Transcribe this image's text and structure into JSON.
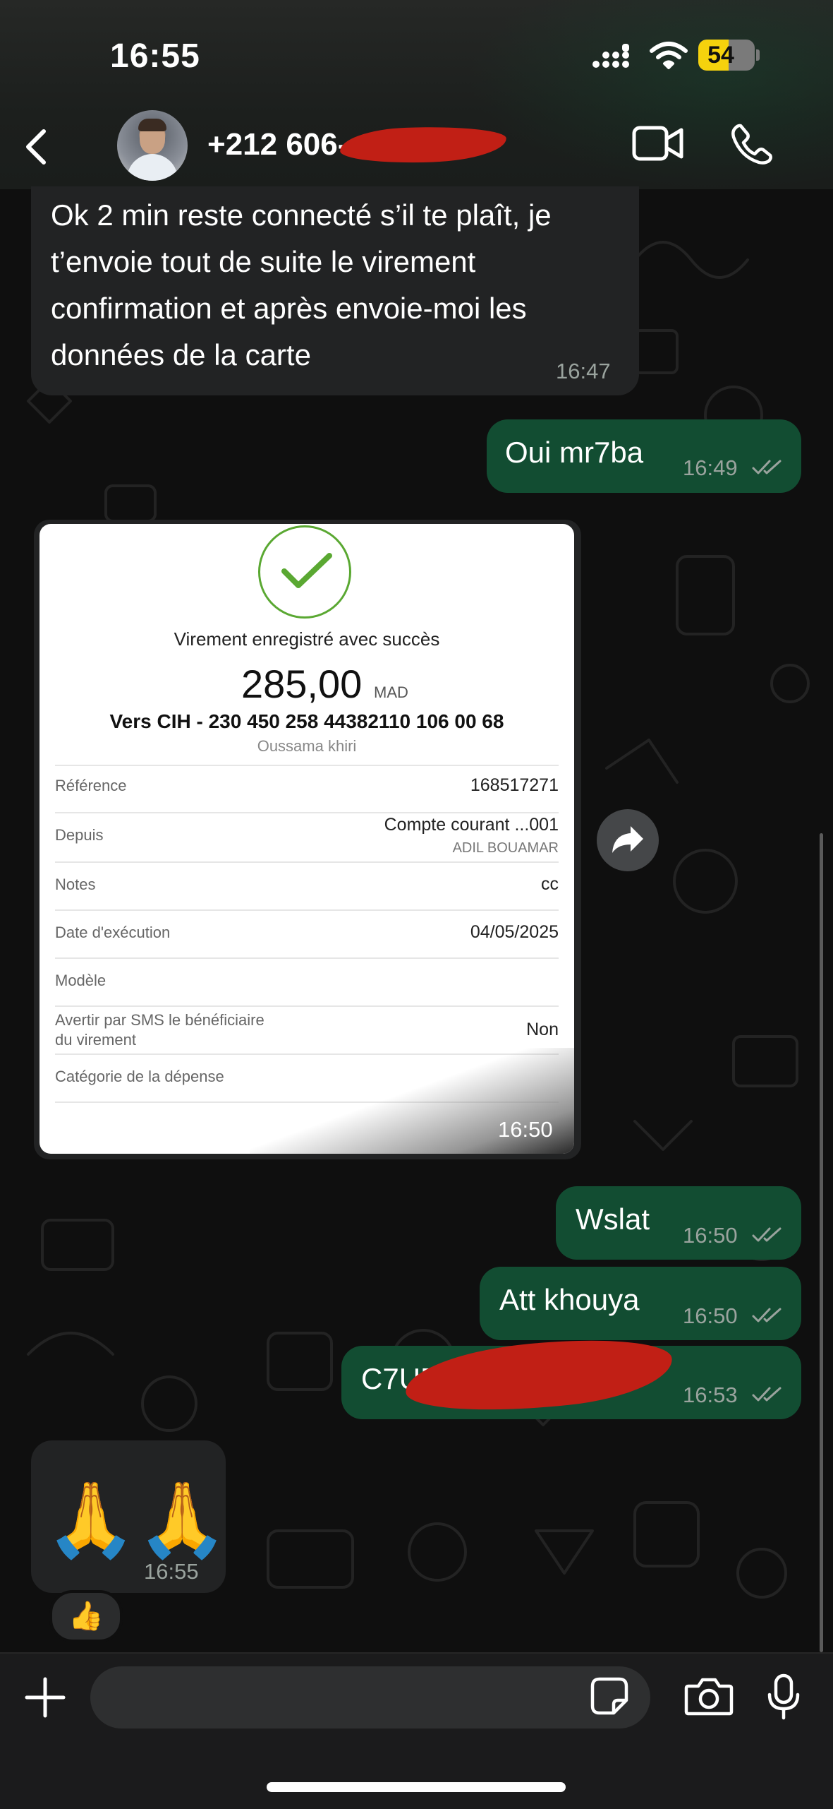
{
  "status_bar": {
    "time": "16:55",
    "battery": "54",
    "battery_level": 0.54
  },
  "header": {
    "contact": "+212 606-"
  },
  "messages": {
    "m1": {
      "lines": [
        "Ok 2 min reste connecté s’il te plaît, je",
        "t’envoie tout de suite le virement",
        "confirmation et après envoie-moi les",
        "données de la carte"
      ],
      "time": "16:47"
    },
    "m2": {
      "text": "Oui mr7ba",
      "time": "16:49"
    },
    "m3": {
      "time": "16:50"
    },
    "m4": {
      "text": "Wslat",
      "time": "16:50"
    },
    "m5": {
      "text": "Att khouya",
      "time": "16:50"
    },
    "m6": {
      "text": "C7URF",
      "time": "16:53"
    },
    "m7": {
      "text": "🙏🙏",
      "time": "16:55",
      "reaction": "👍"
    }
  },
  "receipt": {
    "title": "Virement enregistré avec succès",
    "amount": "285,00",
    "currency": "MAD",
    "destination": "Vers CIH - 230 450 258 44382110 106 00 68",
    "beneficiary": "Oussama khiri",
    "rows": [
      {
        "label": "Référence",
        "value": "168517271"
      },
      {
        "label": "Depuis",
        "value": "Compte courant ...001",
        "sub": "ADIL BOUAMAR"
      },
      {
        "label": "Notes",
        "value": "cc"
      },
      {
        "label": "Date d'exécution",
        "value": "04/05/2025"
      },
      {
        "label": "Modèle",
        "value": ""
      },
      {
        "label_lines": [
          "Avertir par SMS le bénéficiaire",
          "du virement"
        ],
        "value": "Non"
      },
      {
        "label": "Catégorie de la dépense",
        "value": ""
      }
    ]
  },
  "input": {
    "placeholder": ""
  },
  "colors": {
    "outgoing_bubble": "#124d32",
    "incoming_bubble": "#222324",
    "success_check": "#5aa832",
    "redaction": "#c11f15"
  }
}
